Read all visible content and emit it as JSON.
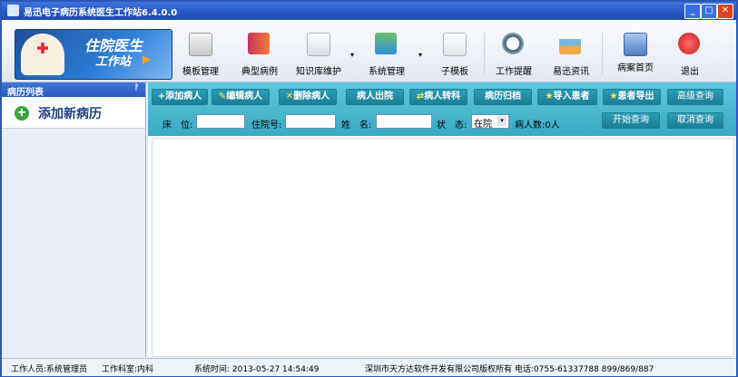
{
  "window": {
    "title": "易迅电子病历系统医生工作站6.4.0.0",
    "min": "_",
    "max": "□",
    "close": "✕"
  },
  "logo": {
    "line1": "住院医生",
    "line2": "工作站",
    "arrow": "▶"
  },
  "toolbar": {
    "template_mgmt": "模板管理",
    "typical_cases": "典型病例",
    "knowledge_base": "知识库维护",
    "system_mgmt": "系统管理",
    "sub_template": "子模板",
    "work_reminder": "工作提醒",
    "yixun_news": "易迅资讯",
    "record_home": "病案首页",
    "exit": "退出",
    "dropdown_mark": "▾"
  },
  "left_panel": {
    "header": "病历列表",
    "pin": "ᚹ",
    "add_new": "添加新病历",
    "plus": "+"
  },
  "actions": {
    "add_patient": "+添加病人",
    "edit_patient": "编辑病人",
    "delete_patient": "删除病人",
    "discharge": "病人出院",
    "transfer": "病人转科",
    "archive": "病历归档",
    "import_patient": "导入患者",
    "export_patient": "患者导出",
    "advanced_query": "高级查询",
    "start_query": "开始查询",
    "cancel_query": "取消查询"
  },
  "filters": {
    "bed_label": "床　位:",
    "admission_label": "住院号:",
    "name_label": "姓　名:",
    "status_label": "状　态:",
    "status_value": "在院",
    "patient_count": "病人数:0人"
  },
  "status_bar": {
    "staff": "工作人员:系统管理员",
    "dept": "工作科室:内科",
    "system_time": "系统时间: 2013-05-27 14:54:49",
    "copyright": "深圳市天方达软件开发有限公司版权所有 电话:0755-61337788 899/869/887"
  },
  "colors": {
    "title_bar": "#2556c4",
    "action_bar": "#3aa9c4",
    "action_button": "#1c7f98"
  }
}
